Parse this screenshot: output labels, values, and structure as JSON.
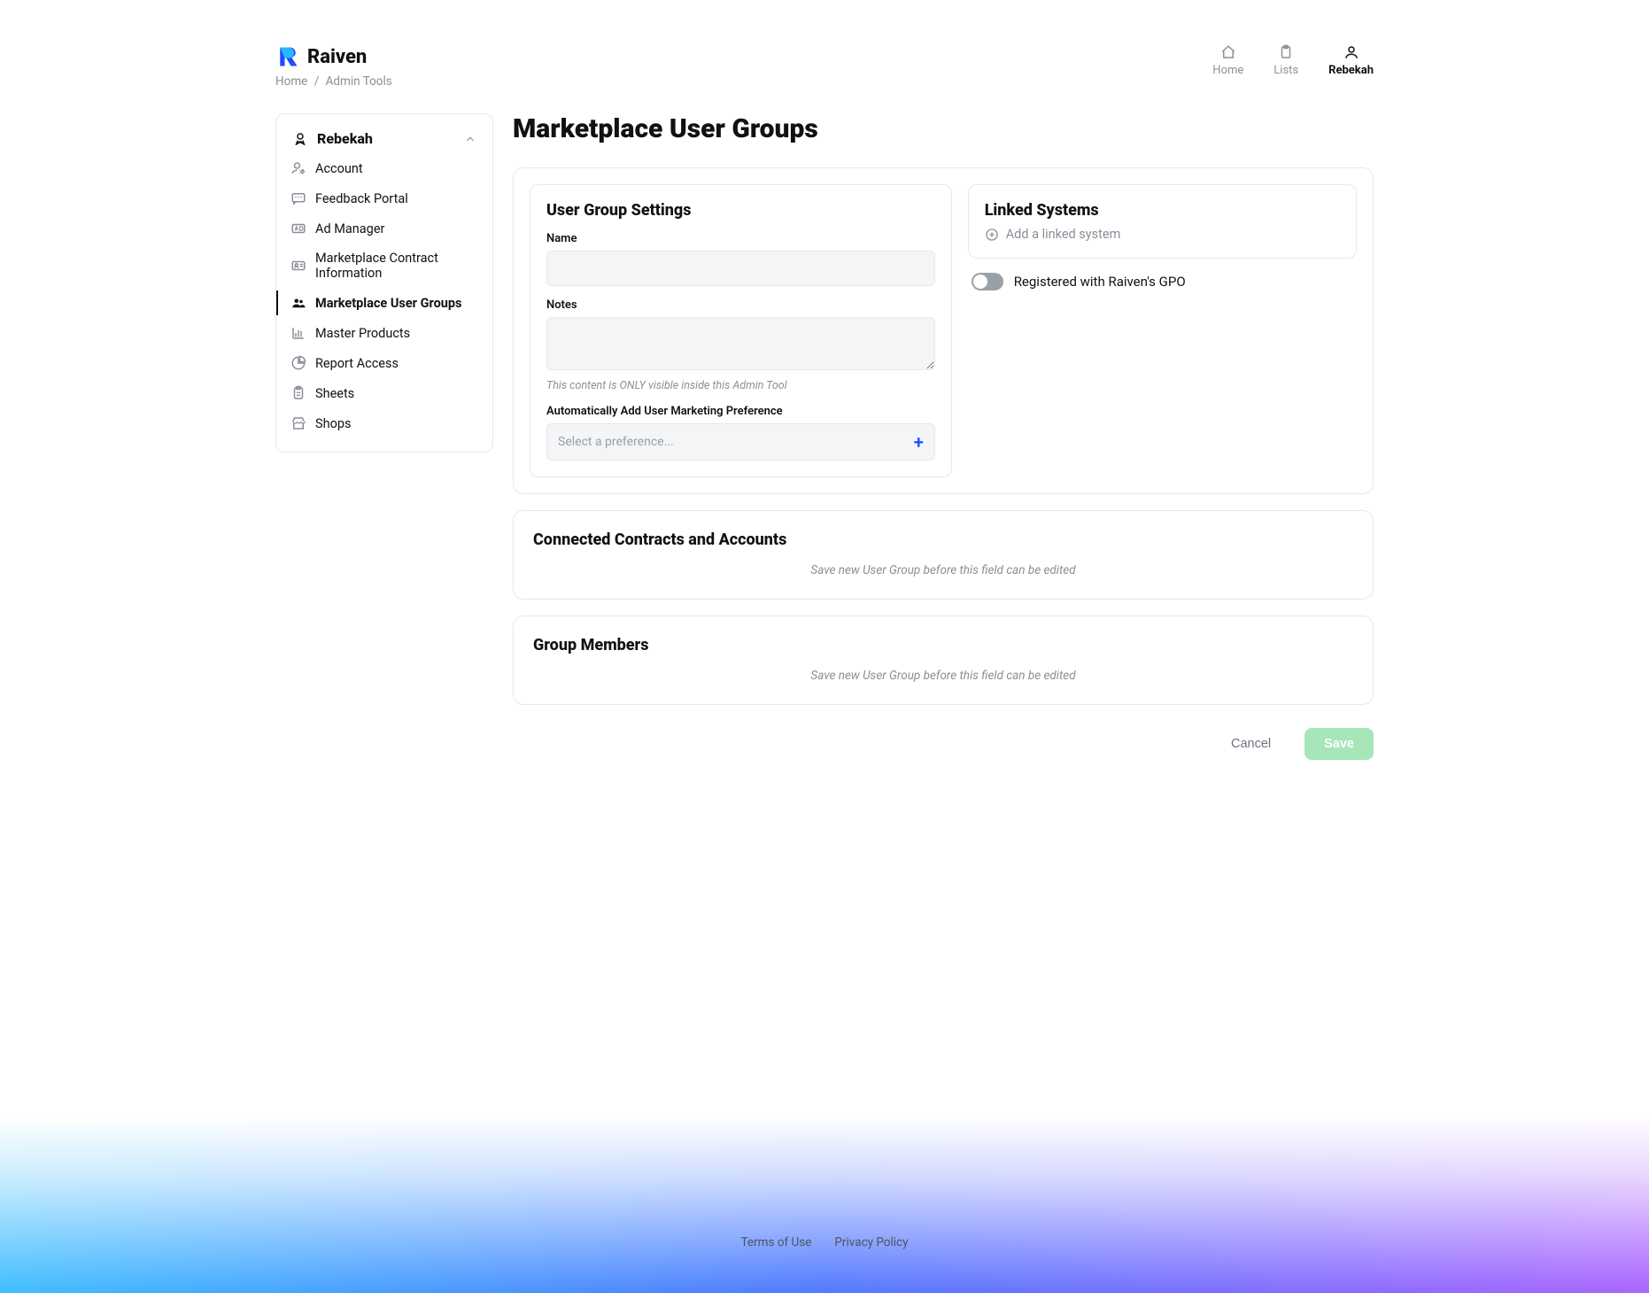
{
  "brand": {
    "name": "Raiven"
  },
  "breadcrumbs": {
    "home": "Home",
    "current": "Admin Tools"
  },
  "header_nav": {
    "home": "Home",
    "lists": "Lists",
    "user": "Rebekah"
  },
  "sidebar": {
    "title": "Rebekah",
    "items": [
      {
        "label": "Account"
      },
      {
        "label": "Feedback Portal"
      },
      {
        "label": "Ad Manager"
      },
      {
        "label": "Marketplace Contract Information"
      },
      {
        "label": "Marketplace User Groups"
      },
      {
        "label": "Master Products"
      },
      {
        "label": "Report Access"
      },
      {
        "label": "Sheets"
      },
      {
        "label": "Shops"
      }
    ]
  },
  "main": {
    "title": "Marketplace User Groups",
    "settings": {
      "heading": "User Group Settings",
      "name_label": "Name",
      "name_value": "",
      "notes_label": "Notes",
      "notes_value": "",
      "notes_helper": "This content is ONLY visible inside this Admin Tool",
      "preference_label": "Automatically Add User Marketing Preference",
      "preference_placeholder": "Select a preference..."
    },
    "linked": {
      "heading": "Linked Systems",
      "add_label": "Add a linked system"
    },
    "gpo_label": "Registered with Raiven's GPO",
    "contracts": {
      "heading": "Connected Contracts and Accounts",
      "placeholder": "Save new User Group before this field can be edited"
    },
    "members": {
      "heading": "Group Members",
      "placeholder": "Save new User Group before this field can be edited"
    },
    "actions": {
      "cancel": "Cancel",
      "save": "Save"
    }
  },
  "footer": {
    "terms": "Terms of Use",
    "privacy": "Privacy Policy"
  }
}
